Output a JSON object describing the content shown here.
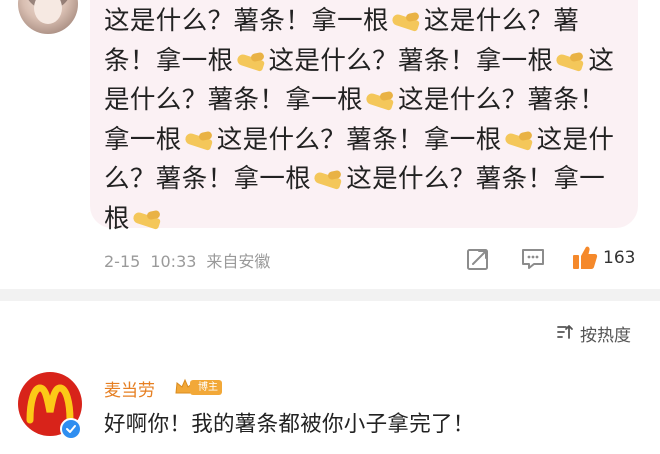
{
  "post": {
    "text_segments": [
      {
        "t": "这是什么？薯条！拿一根"
      },
      {
        "emoji": "pinching-hand"
      },
      {
        "t": "这是什么？薯条！拿一根"
      },
      {
        "emoji": "pinching-hand"
      },
      {
        "t": "这是什么？薯条！拿一根"
      },
      {
        "emoji": "pinching-hand"
      },
      {
        "t": "这是什么？薯条！拿一根"
      },
      {
        "emoji": "pinching-hand"
      },
      {
        "t": "这是什么？薯条！拿一根"
      },
      {
        "emoji": "pinching-hand"
      },
      {
        "t": "这是什么？薯条！拿一根"
      },
      {
        "emoji": "pinching-hand"
      },
      {
        "t": "这是什么？薯条！拿一根"
      },
      {
        "emoji": "pinching-hand"
      },
      {
        "t": "这是什么？薯条！拿一根"
      },
      {
        "emoji": "pinching-hand"
      }
    ],
    "date": "2-15",
    "time": "10:33",
    "source": "来自安徽",
    "likes": "163",
    "accent_like_color": "#f5892b"
  },
  "sort": {
    "label": "按热度",
    "icon": "sort-icon"
  },
  "comment": {
    "author": "麦当劳",
    "badge_label": "博主",
    "text": "好啊你！我的薯条都被你小子拿完了！",
    "author_color": "#e67f22",
    "avatar_color": "#d8231a"
  }
}
